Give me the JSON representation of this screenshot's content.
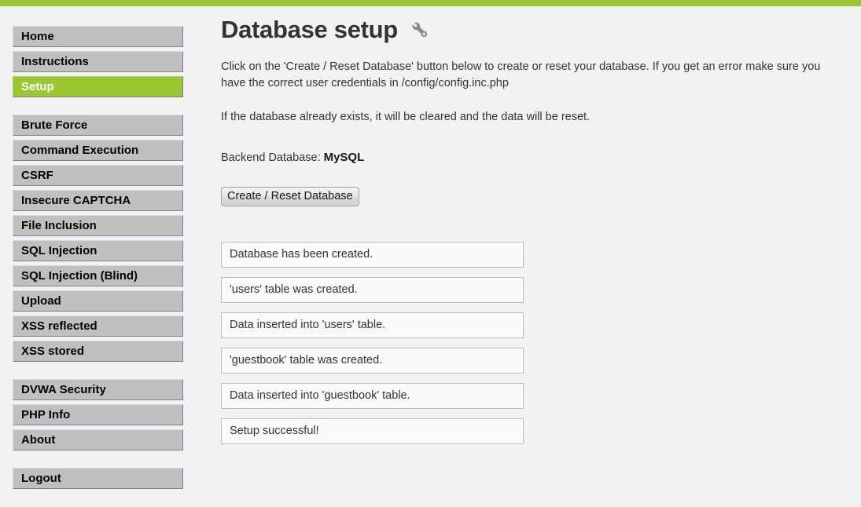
{
  "theme": {
    "accent_green": "#9bc832",
    "nav_button_gray": "#c0c0c0",
    "page_background": "#f2f2f2",
    "message_box_background": "#fafafa"
  },
  "sidebar": {
    "groups": [
      {
        "name": "primary",
        "items": [
          {
            "label": "Home",
            "active": false
          },
          {
            "label": "Instructions",
            "active": false
          },
          {
            "label": "Setup",
            "active": true
          }
        ]
      },
      {
        "name": "vulnerabilities",
        "items": [
          {
            "label": "Brute Force",
            "active": false
          },
          {
            "label": "Command Execution",
            "active": false
          },
          {
            "label": "CSRF",
            "active": false
          },
          {
            "label": "Insecure CAPTCHA",
            "active": false
          },
          {
            "label": "File Inclusion",
            "active": false
          },
          {
            "label": "SQL Injection",
            "active": false
          },
          {
            "label": "SQL Injection (Blind)",
            "active": false
          },
          {
            "label": "Upload",
            "active": false
          },
          {
            "label": "XSS reflected",
            "active": false
          },
          {
            "label": "XSS stored",
            "active": false
          }
        ]
      },
      {
        "name": "tools",
        "items": [
          {
            "label": "DVWA Security",
            "active": false
          },
          {
            "label": "PHP Info",
            "active": false
          },
          {
            "label": "About",
            "active": false
          }
        ]
      },
      {
        "name": "session",
        "items": [
          {
            "label": "Logout",
            "active": false
          }
        ]
      }
    ]
  },
  "main": {
    "title": "Database setup",
    "title_icon": "wrench-icon",
    "intro_paragraph": "Click on the 'Create / Reset Database' button below to create or reset your database. If you get an error make sure you have the correct user credentials in /config/config.inc.php",
    "reset_note": "If the database already exists, it will be cleared and the data will be reset.",
    "backend_label": "Backend Database:",
    "backend_value": "MySQL",
    "create_reset_button": "Create / Reset Database",
    "messages": [
      "Database has been created.",
      "'users' table was created.",
      "Data inserted into 'users' table.",
      "'guestbook' table was created.",
      "Data inserted into 'guestbook' table.",
      "Setup successful!"
    ]
  }
}
